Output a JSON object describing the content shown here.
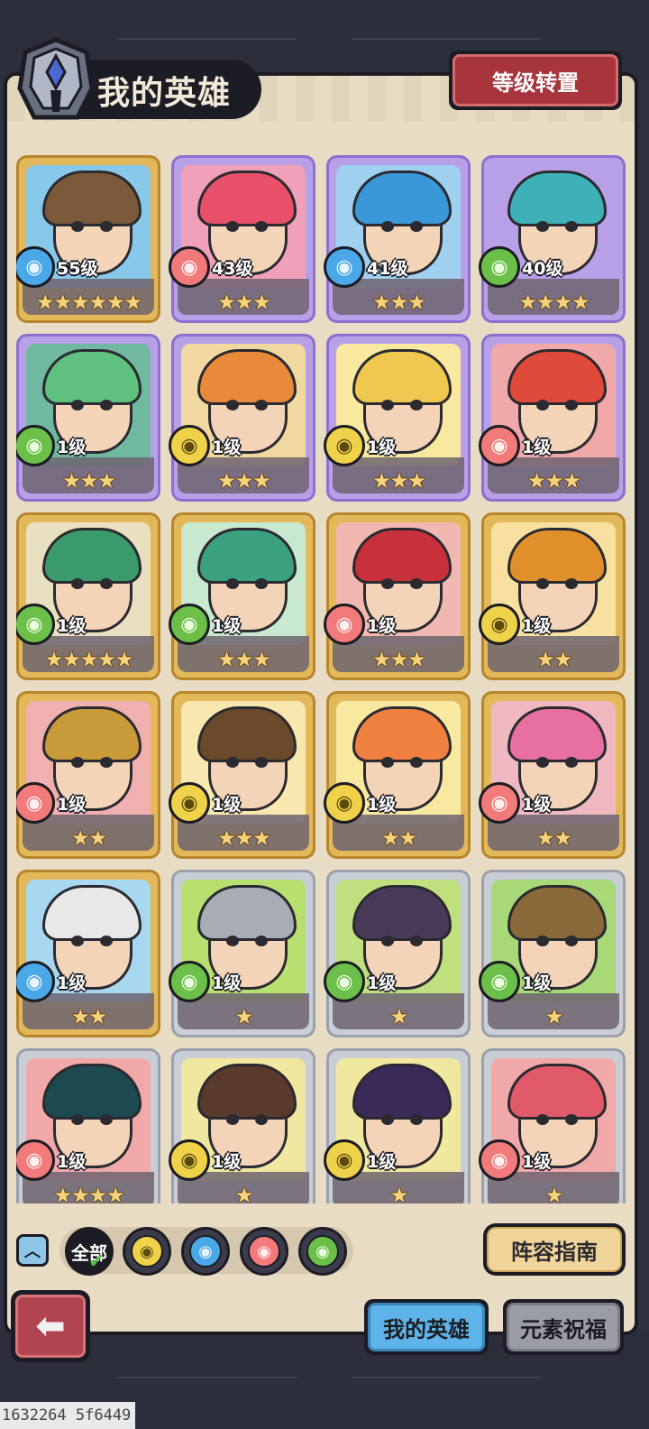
{
  "header": {
    "title": "我的英雄",
    "level_transfer_label": "等级转置"
  },
  "heroes": [
    {
      "level": "55级",
      "element": "water",
      "stars": 6,
      "frame": "gold",
      "accent": "#7a5a3a",
      "bg": "#88c8e8"
    },
    {
      "level": "43级",
      "element": "fire",
      "stars": 3,
      "frame": "purple",
      "accent": "#e8506a",
      "bg": "#f0a0b8"
    },
    {
      "level": "41级",
      "element": "water",
      "stars": 3,
      "frame": "purple",
      "accent": "#3a98d8",
      "bg": "#a0d0f0"
    },
    {
      "level": "40级",
      "element": "wind",
      "stars": 4,
      "frame": "purple",
      "accent": "#40b0b8",
      "bg": "#b8a0e8"
    },
    {
      "level": "1级",
      "element": "wind",
      "stars": 3,
      "frame": "purple",
      "accent": "#60c080",
      "bg": "#70b8a0"
    },
    {
      "level": "1级",
      "element": "earth",
      "stars": 3,
      "frame": "purple",
      "accent": "#e88a3a",
      "bg": "#f0d8a0"
    },
    {
      "level": "1级",
      "element": "earth",
      "stars": 3,
      "frame": "purple",
      "accent": "#f0c850",
      "bg": "#f8e8a0"
    },
    {
      "level": "1级",
      "element": "fire",
      "stars": 3,
      "frame": "purple",
      "accent": "#e04a3a",
      "bg": "#f0a8a8"
    },
    {
      "level": "1级",
      "element": "wind",
      "stars": 5,
      "frame": "gold",
      "accent": "#3a9a6a",
      "bg": "#e8e0c0"
    },
    {
      "level": "1级",
      "element": "wind",
      "stars": 3,
      "frame": "gold",
      "accent": "#3aa080",
      "bg": "#c8e8d0"
    },
    {
      "level": "1级",
      "element": "fire",
      "stars": 3,
      "frame": "gold",
      "accent": "#c8303a",
      "bg": "#f0b8b0"
    },
    {
      "level": "1级",
      "element": "earth",
      "stars": 2,
      "frame": "gold",
      "accent": "#e0902a",
      "bg": "#f8e0a0"
    },
    {
      "level": "1级",
      "element": "fire",
      "stars": 2,
      "frame": "gold",
      "accent": "#c89a3a",
      "bg": "#f0b0b0"
    },
    {
      "level": "1级",
      "element": "earth",
      "stars": 3,
      "frame": "gold",
      "accent": "#6a4a2a",
      "bg": "#f8e8b0"
    },
    {
      "level": "1级",
      "element": "earth",
      "stars": 2,
      "frame": "gold",
      "accent": "#f08040",
      "bg": "#f8e8a0"
    },
    {
      "level": "1级",
      "element": "fire",
      "stars": 2,
      "frame": "gold",
      "accent": "#e870a0",
      "bg": "#f0b8c0"
    },
    {
      "level": "1级",
      "element": "water",
      "stars": 2,
      "frame": "gold",
      "accent": "#e8e8e8",
      "bg": "#a8d8f0"
    },
    {
      "level": "1级",
      "element": "wind",
      "stars": 1,
      "frame": "silver",
      "accent": "#a8acb4",
      "bg": "#b8e070"
    },
    {
      "level": "1级",
      "element": "wind",
      "stars": 1,
      "frame": "silver",
      "accent": "#4a3a5a",
      "bg": "#c0e080"
    },
    {
      "level": "1级",
      "element": "wind",
      "stars": 1,
      "frame": "silver",
      "accent": "#8a6a3a",
      "bg": "#a8d878"
    },
    {
      "level": "1级",
      "element": "fire",
      "stars": 4,
      "frame": "silver",
      "accent": "#1c4a50",
      "bg": "#f0a8a8"
    },
    {
      "level": "1级",
      "element": "earth",
      "stars": 1,
      "frame": "silver",
      "accent": "#5a3a2a",
      "bg": "#f0e8a0"
    },
    {
      "level": "1级",
      "element": "earth",
      "stars": 1,
      "frame": "silver",
      "accent": "#3a2a5a",
      "bg": "#f0e8a0"
    },
    {
      "level": "1级",
      "element": "fire",
      "stars": 1,
      "frame": "silver",
      "accent": "#e05a6a",
      "bg": "#f0a8a8"
    }
  ],
  "filters": {
    "all_label": "全部",
    "elements": [
      "earth",
      "water",
      "fire",
      "wind"
    ]
  },
  "element_colors": {
    "water": "#4aa8e8",
    "fire": "#f27a7a",
    "wind": "#6cc04a",
    "earth": "#f0d24a"
  },
  "buttons": {
    "lineup_guide": "阵容指南"
  },
  "tabs": [
    {
      "label": "我的英雄",
      "active": true
    },
    {
      "label": "元素祝福",
      "active": false
    }
  ],
  "build_id": "1632264 5f6449"
}
